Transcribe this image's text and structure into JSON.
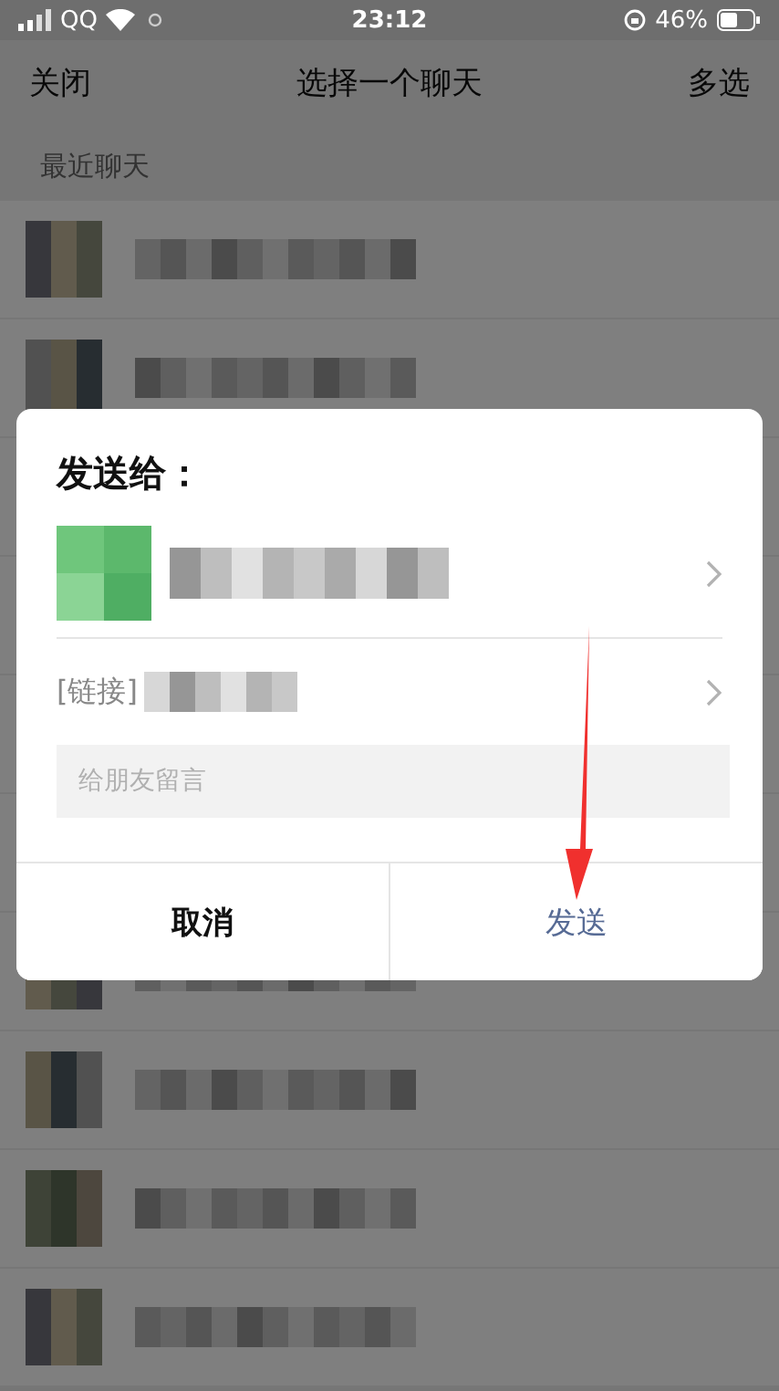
{
  "status_bar": {
    "carrier": "QQ",
    "time": "23:12",
    "battery": "46%"
  },
  "header": {
    "left": "关闭",
    "title": "选择一个聊天",
    "right": "多选"
  },
  "section_title": "最近聊天",
  "dialog": {
    "title": "发送给：",
    "link_label": "[链接]",
    "placeholder": "给朋友留言",
    "buttons": [
      {
        "label": "取消",
        "kind": "cancel"
      },
      {
        "label": "发送",
        "kind": "confirm"
      }
    ]
  }
}
